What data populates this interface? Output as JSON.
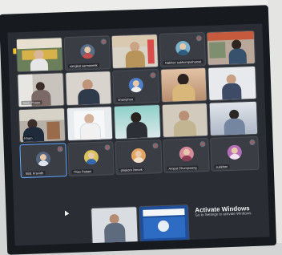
{
  "meeting": {
    "participants": [
      {
        "name": ""
      },
      {
        "name": "sangkat sarmaseek"
      },
      {
        "name": ""
      },
      {
        "name": ""
      },
      {
        "name": "Nakhon sukhumputhamet"
      },
      {
        "name": ""
      },
      {
        "name": "Sekh Phoon"
      },
      {
        "name": ""
      },
      {
        "name": "khamphoo"
      },
      {
        "name": ""
      },
      {
        "name": ""
      },
      {
        "name": "Kham"
      },
      {
        "name": ""
      },
      {
        "name": ""
      },
      {
        "name": ""
      },
      {
        "name": ""
      },
      {
        "name": ""
      },
      {
        "name": "SEE Kravidh"
      },
      {
        "name": "Thao Pattani"
      },
      {
        "name": "phakorn Nmork"
      },
      {
        "name": "Amput Chumpwong"
      },
      {
        "name": "sukkhon"
      }
    ],
    "icons": [
      "mic-muted-icon",
      "avatar-icon"
    ]
  },
  "system": {
    "activate_title": "Activate Windows",
    "activate_sub": "Go to Settings to activate Windows."
  },
  "colors": {
    "screen": "#2a2d33",
    "tile": "#3a3d44",
    "active_border": "#5ea6ff",
    "indicator": "#f2c230"
  }
}
